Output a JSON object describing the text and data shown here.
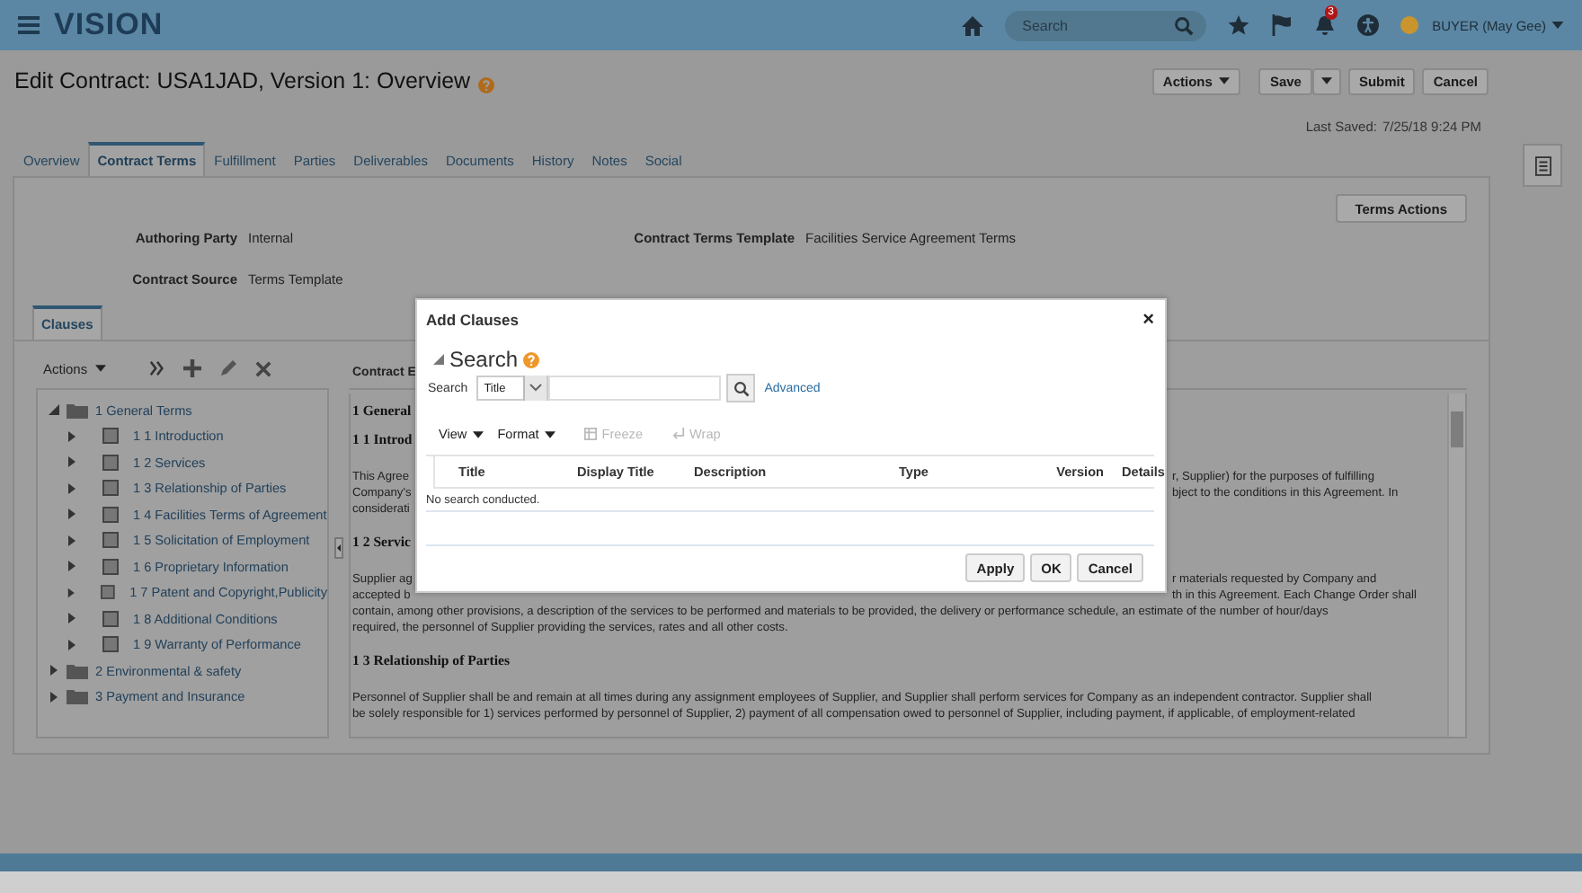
{
  "header": {
    "logo": "VISION",
    "search": {
      "placeholder": "Search"
    },
    "notifications_badge": "3",
    "user": "BUYER (May Gee)"
  },
  "page": {
    "title": "Edit Contract: USA1JAD, Version 1: Overview",
    "buttons": [
      {
        "label": "Actions",
        "kind": "menu"
      },
      {
        "label": "Save",
        "kind": "split"
      },
      {
        "label": "Submit",
        "kind": "plain"
      },
      {
        "label": "Cancel",
        "kind": "plain"
      }
    ],
    "last_saved_label": "Last Saved:",
    "last_saved": "7/25/18 9:24 PM"
  },
  "tabs": [
    {
      "label": "Overview",
      "selected": false
    },
    {
      "label": "Contract Terms",
      "selected": true
    },
    {
      "label": "Fulfillment",
      "selected": false
    },
    {
      "label": "Parties",
      "selected": false
    },
    {
      "label": "Deliverables",
      "selected": false
    },
    {
      "label": "Documents",
      "selected": false
    },
    {
      "label": "History",
      "selected": false
    },
    {
      "label": "Notes",
      "selected": false
    },
    {
      "label": "Social",
      "selected": false
    }
  ],
  "terms_actions": "Terms Actions",
  "fields": [
    {
      "label": "Authoring Party",
      "value": "Internal"
    },
    {
      "label": "Contract Terms Template",
      "value": "Facilities Service Agreement Terms"
    },
    {
      "label": "Contract Source",
      "value": "Terms Template"
    }
  ],
  "clauses_tab": "Clauses",
  "tree": {
    "actions": "Actions",
    "items": [
      {
        "label": "1 General Terms",
        "expanded": true,
        "children": [
          {
            "label": "1 1 Introduction",
            "expanded": false
          },
          {
            "label": "1 2 Services",
            "expanded": false
          },
          {
            "label": "1 3 Relationship of Parties",
            "expanded": false
          },
          {
            "label": "1 4 Facilities Terms of Agreement",
            "expanded": false
          },
          {
            "label": "1 5 Solicitation of Employment",
            "expanded": false
          },
          {
            "label": "1 6 Proprietary Information",
            "expanded": false
          },
          {
            "label": "1 7 Patent and Copyright,Publicity",
            "expanded": false
          },
          {
            "label": "1 8 Additional Conditions",
            "expanded": false
          },
          {
            "label": "1 9 Warranty of Performance",
            "expanded": false
          }
        ]
      },
      {
        "label": "2 Environmental & safety",
        "expanded": false
      },
      {
        "label": "3 Payment and Insurance",
        "expanded": false
      }
    ]
  },
  "document": {
    "header": "Contract E",
    "blocks": [
      {
        "kind": "heading",
        "left": "1 General"
      },
      {
        "kind": "heading",
        "left": "1 1 Introd"
      },
      {
        "kind": "line",
        "left": "This Agree",
        "right": "r, Supplier) for the purposes of fulfilling"
      },
      {
        "kind": "line",
        "left": "Company's",
        "right": "bject to the conditions in this Agreement. In"
      },
      {
        "kind": "line",
        "left": "considerati"
      },
      {
        "kind": "heading",
        "left": "1 2 Servic"
      },
      {
        "kind": "line",
        "left": "Supplier ag",
        "right": "r materials requested by Company and"
      },
      {
        "kind": "line",
        "left": "accepted b",
        "right": "th in this Agreement. Each Change Order shall"
      },
      {
        "kind": "line",
        "left": "contain, among other provisions, a description of the services to be performed and materials to be provided, the delivery or performance schedule, an estimate of the number of hour/days"
      },
      {
        "kind": "line",
        "left": "required, the personnel of Supplier providing the services, rates and all other costs."
      },
      {
        "kind": "heading",
        "left": "1 3 Relationship of Parties"
      },
      {
        "kind": "line",
        "left": "Personnel of Supplier shall be and remain at all times during any assignment employees of Supplier, and Supplier shall perform services for Company as an independent contractor. Supplier shall"
      },
      {
        "kind": "line",
        "left": "be solely responsible for 1) services performed by personnel of Supplier, 2) payment of all compensation owed to personnel of Supplier, including payment, if applicable, of employment-related"
      }
    ]
  },
  "dialog": {
    "title": "Add Clauses",
    "close": "×",
    "section": "Search",
    "search_label": "Search",
    "search_by": "Title",
    "advanced": "Advanced",
    "toolbar": [
      {
        "label": "View",
        "kind": "menu",
        "disabled": false
      },
      {
        "label": "Format",
        "kind": "menu",
        "disabled": false
      },
      {
        "label": "Freeze",
        "kind": "freeze",
        "disabled": true
      },
      {
        "label": "Wrap",
        "kind": "wrap",
        "disabled": true
      }
    ],
    "columns": [
      "Title",
      "Display Title",
      "Description",
      "Type",
      "Version",
      "Details"
    ],
    "empty_text": "No search conducted.",
    "buttons": [
      "Apply",
      "OK",
      "Cancel"
    ]
  }
}
